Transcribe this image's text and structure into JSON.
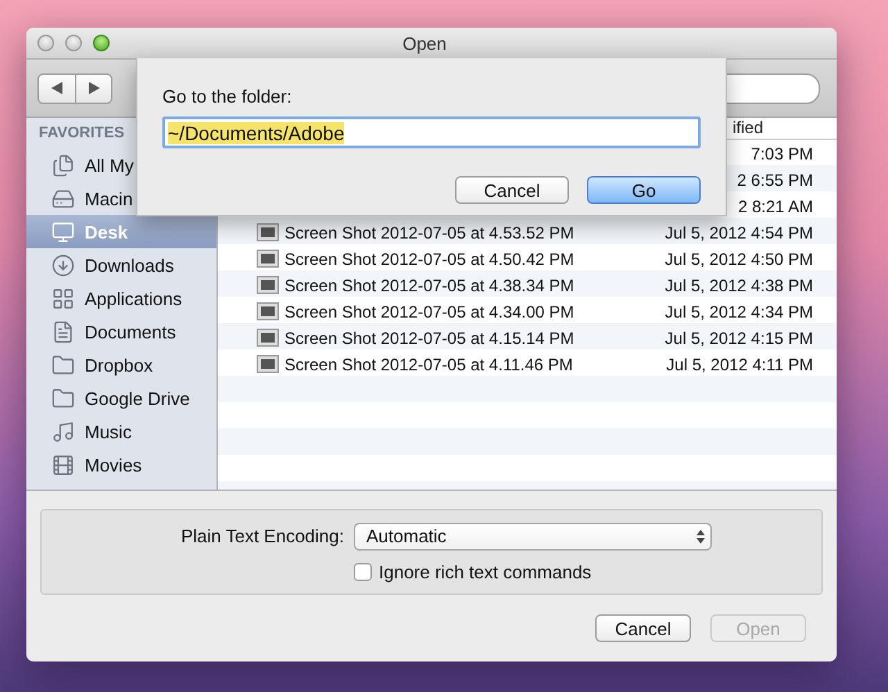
{
  "window": {
    "title": "Open"
  },
  "sidebar": {
    "header": "FAVORITES",
    "items": [
      {
        "label": "All My",
        "selected": false
      },
      {
        "label": "Macin",
        "selected": false
      },
      {
        "label": "Desk",
        "selected": true
      },
      {
        "label": "Downloads",
        "selected": false
      },
      {
        "label": "Applications",
        "selected": false
      },
      {
        "label": "Documents",
        "selected": false
      },
      {
        "label": "Dropbox",
        "selected": false
      },
      {
        "label": "Google Drive",
        "selected": false
      },
      {
        "label": "Music",
        "selected": false
      },
      {
        "label": "Movies",
        "selected": false
      }
    ]
  },
  "file_list": {
    "column_header": "ified",
    "rows": [
      {
        "date": "7:03 PM"
      },
      {
        "date": "2 6:55 PM"
      },
      {
        "date": "2 8:21 AM"
      },
      {
        "name": "Screen Shot 2012-07-05 at 4.53.52 PM",
        "date": "Jul 5, 2012 4:54 PM"
      },
      {
        "name": "Screen Shot 2012-07-05 at 4.50.42 PM",
        "date": "Jul 5, 2012 4:50 PM"
      },
      {
        "name": "Screen Shot 2012-07-05 at 4.38.34 PM",
        "date": "Jul 5, 2012 4:38 PM"
      },
      {
        "name": "Screen Shot 2012-07-05 at 4.34.00 PM",
        "date": "Jul 5, 2012 4:34 PM"
      },
      {
        "name": "Screen Shot 2012-07-05 at 4.15.14 PM",
        "date": "Jul 5, 2012 4:15 PM"
      },
      {
        "name": "Screen Shot 2012-07-05 at 4.11.46 PM",
        "date": "Jul 5, 2012 4:11 PM"
      }
    ]
  },
  "options": {
    "encoding_label": "Plain Text Encoding:",
    "encoding_value": "Automatic",
    "ignore_rich_text": {
      "label": "Ignore rich text commands",
      "checked": false
    }
  },
  "buttons": [
    {
      "label": "Cancel",
      "disabled": false
    },
    {
      "label": "Open",
      "disabled": true
    }
  ],
  "sheet": {
    "prompt": "Go to the folder:",
    "path": {
      "value": "~/Documents/Adobe",
      "selected": true
    },
    "buttons": [
      {
        "label": "Cancel",
        "default": false
      },
      {
        "label": "Go",
        "default": true
      }
    ]
  }
}
